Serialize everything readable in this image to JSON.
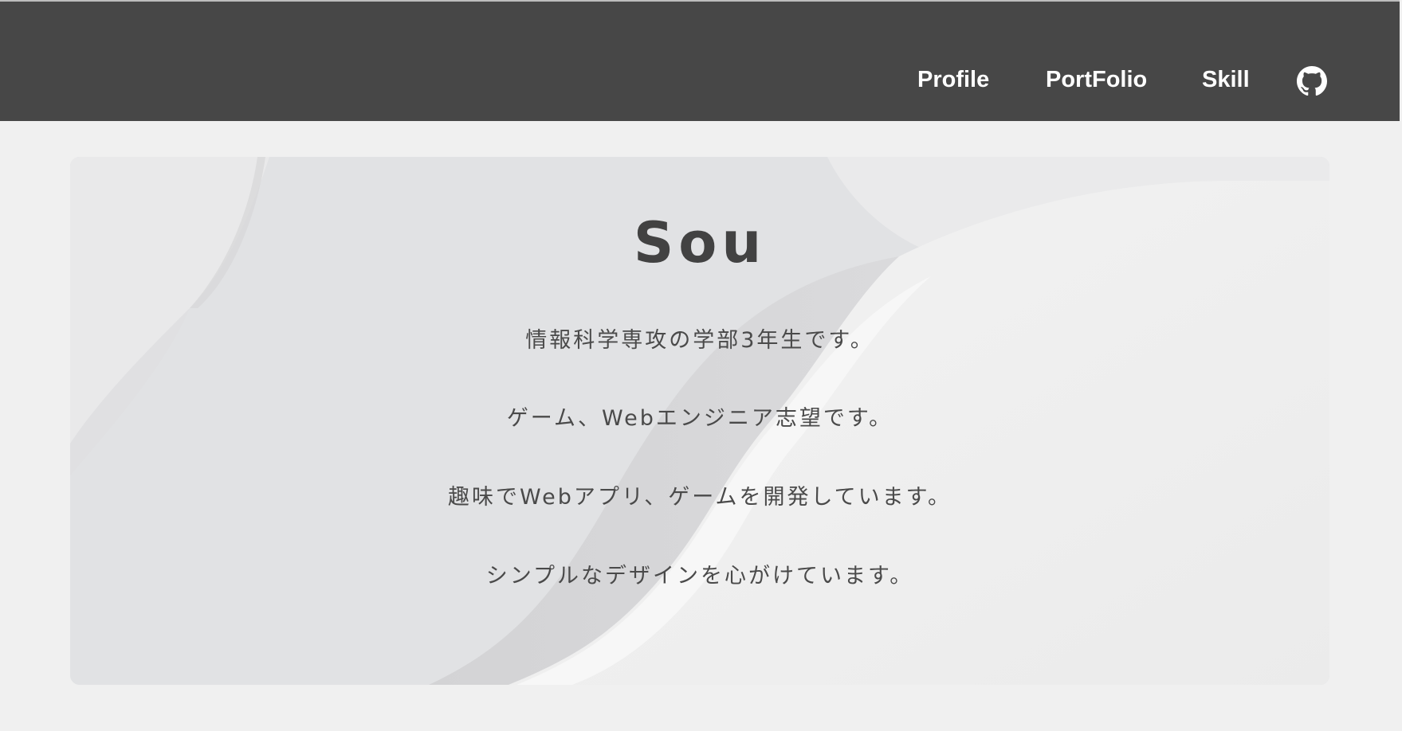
{
  "nav": {
    "items": [
      {
        "label": "Profile"
      },
      {
        "label": "PortFolio"
      },
      {
        "label": "Skill"
      }
    ],
    "github_icon": "github-icon"
  },
  "hero": {
    "title": "Sou",
    "lines": [
      "情報科学専攻の学部3年生です。",
      "ゲーム、Webエンジニア志望です。",
      "趣味でWebアプリ、ゲームを開発しています。",
      "シンプルなデザインを心がけています。"
    ]
  },
  "colors": {
    "header": "#474747",
    "page_background": "#f0f0f0",
    "hero_background": "#e1e2e4",
    "text": "#424242"
  }
}
